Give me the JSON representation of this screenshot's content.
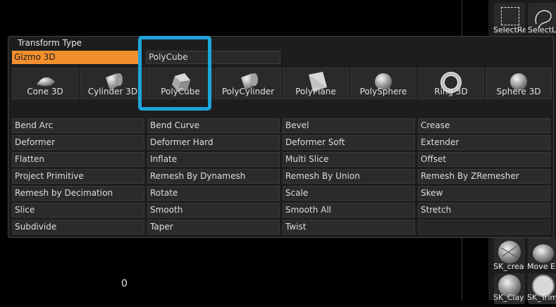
{
  "popup": {
    "title": "Transform Type",
    "selected_gizmo": "Gizmo 3D",
    "selected_field": "PolyCube",
    "icons": [
      {
        "label": "Cone 3D",
        "shape": "cone-icon"
      },
      {
        "label": "Cylinder 3D",
        "shape": "cylinder-icon"
      },
      {
        "label": "PolyCube",
        "shape": "cube-icon"
      },
      {
        "label": "PolyCylinder",
        "shape": "polycylinder-icon"
      },
      {
        "label": "PolyPlane",
        "shape": "plane-icon"
      },
      {
        "label": "PolySphere",
        "shape": "sphere-icon"
      },
      {
        "label": "Ring 3D",
        "shape": "ring-icon"
      },
      {
        "label": "Sphere 3D",
        "shape": "sphere3d-icon"
      }
    ],
    "buttons": [
      [
        "Bend Arc",
        "Bend Curve",
        "Bevel",
        "Crease"
      ],
      [
        "Deformer",
        "Deformer Hard",
        "Deformer Soft",
        "Extender"
      ],
      [
        "Flatten",
        "Inflate",
        "Multi Slice",
        "Offset"
      ],
      [
        "Project Primitive",
        "Remesh By Dynamesh",
        "Remesh By Union",
        "Remesh By ZRemesher"
      ],
      [
        "Remesh by Decimation",
        "Rotate",
        "Scale",
        "Skew"
      ],
      [
        "Slice",
        "Smooth",
        "Smooth All",
        "Stretch"
      ],
      [
        "Subdivide",
        "Taper",
        "Twist"
      ]
    ]
  },
  "right_panel": {
    "labels": [
      "SelectRe",
      "SelectL",
      "SK_crea",
      "Move E",
      "SK_Clay",
      "SK_Trim"
    ]
  },
  "canvas": {
    "value": "0"
  },
  "colors": {
    "accent": "#f3902e",
    "highlight": "#1ea5dc"
  }
}
